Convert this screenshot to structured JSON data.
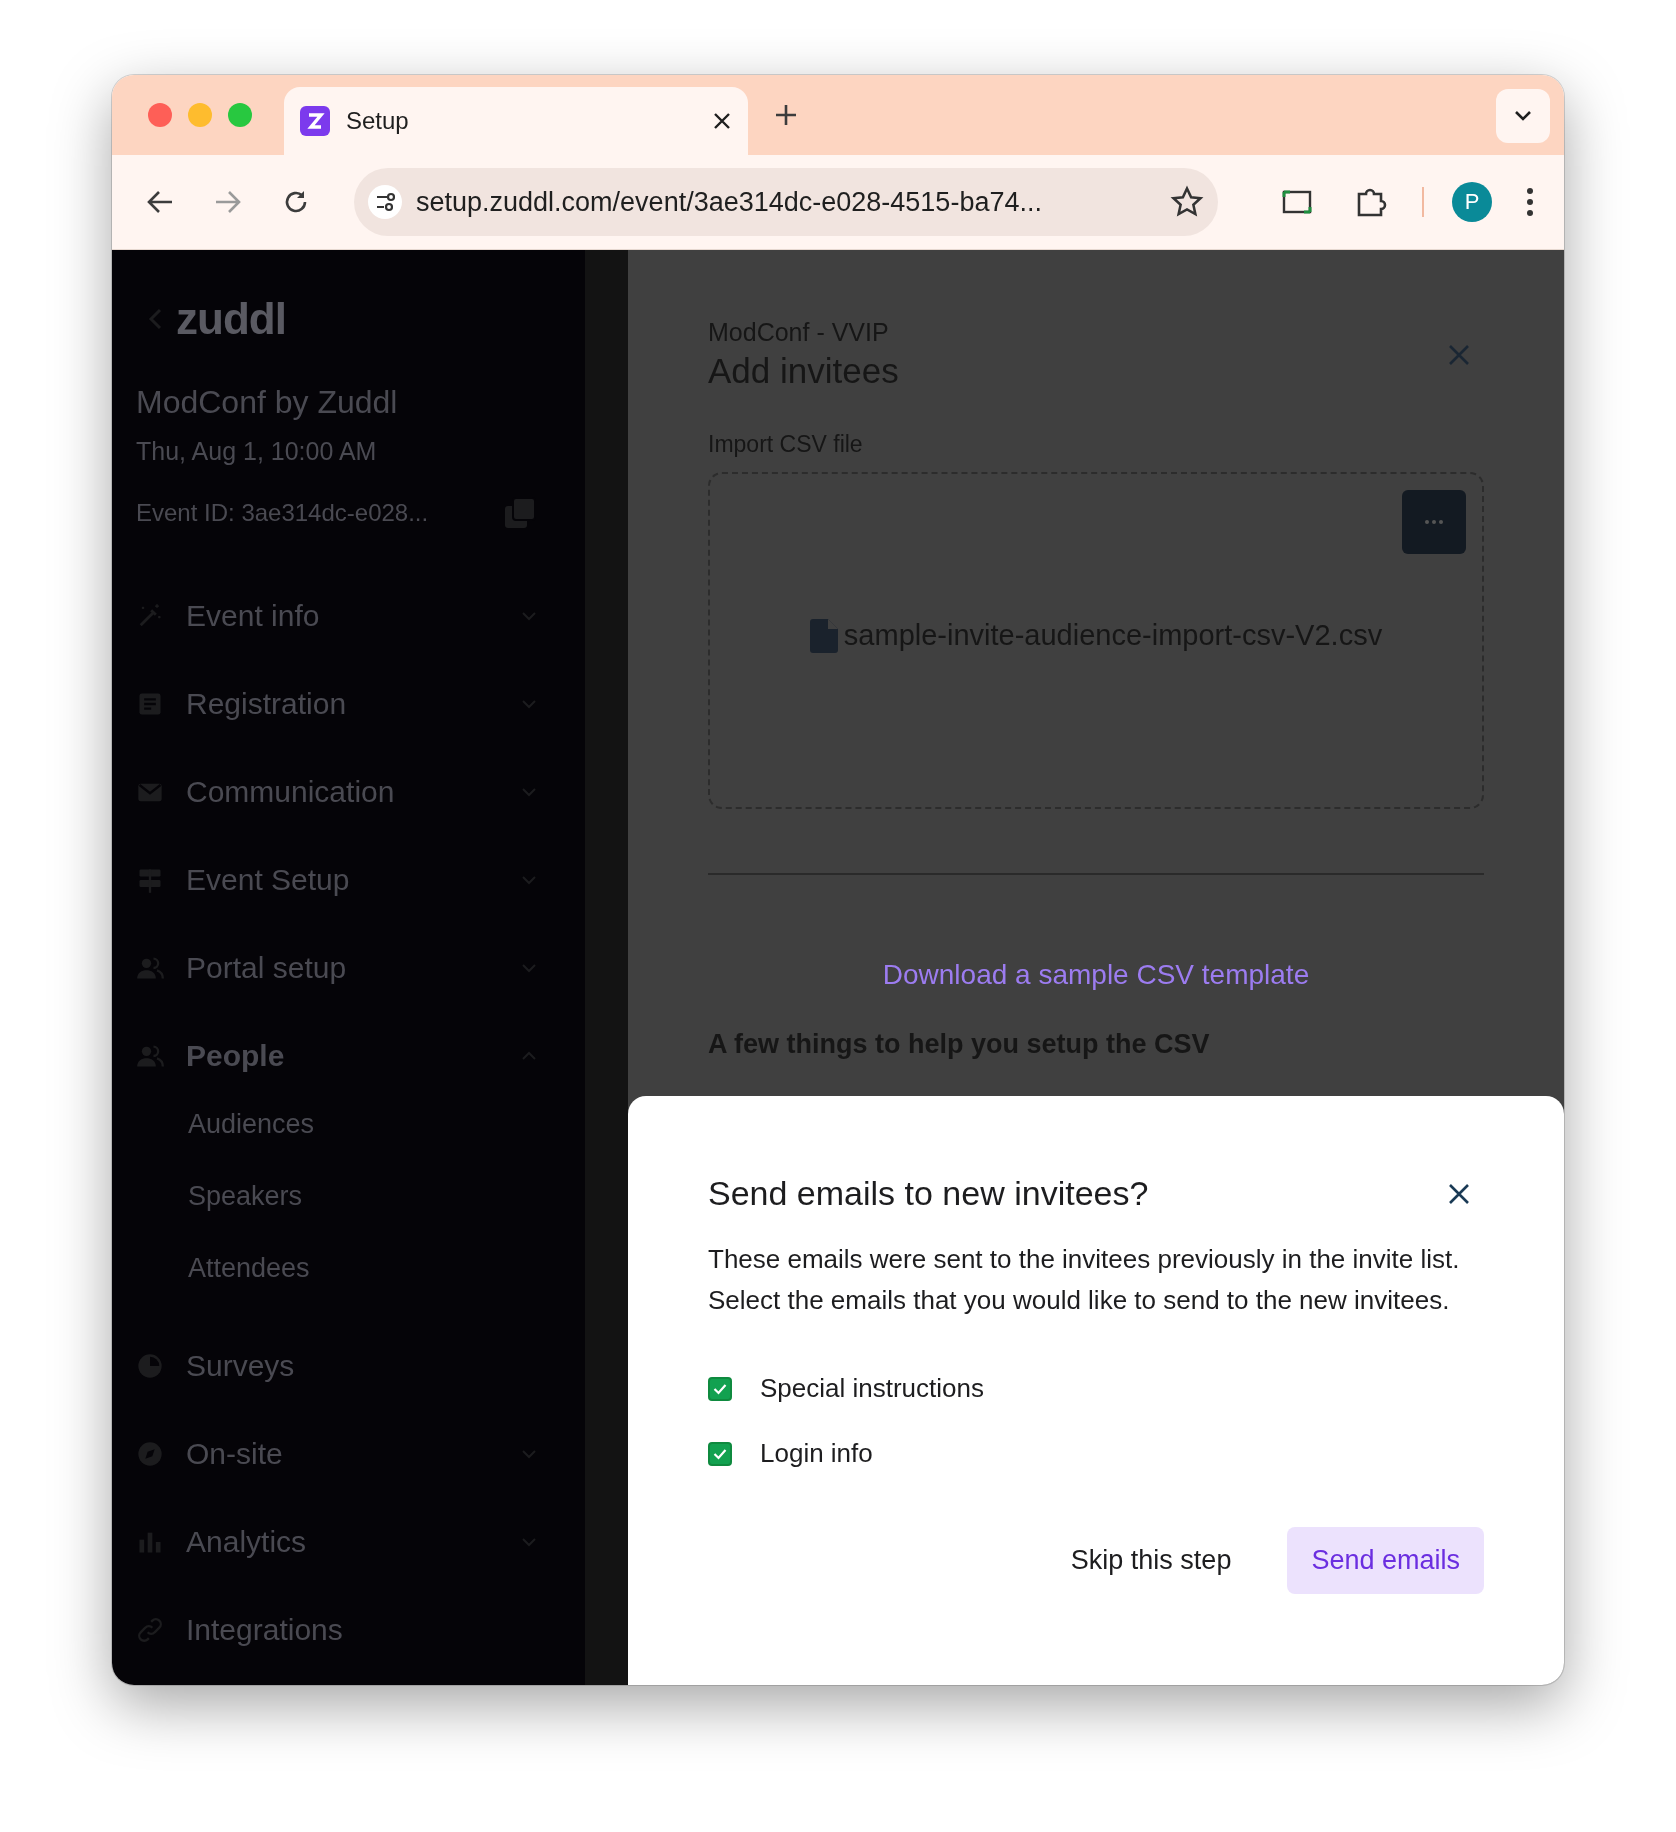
{
  "browser": {
    "tab_title": "Setup",
    "url": "setup.zuddl.com/event/3ae314dc-e028-4515-ba74...",
    "profile_initial": "P"
  },
  "sidebar": {
    "logo": "zuddl",
    "event_name": "ModConf by Zuddl",
    "event_date": "Thu, Aug 1, 10:00 AM",
    "event_id": "Event ID: 3ae314dc-e028...",
    "items": [
      {
        "label": "Event info",
        "kind": "collapsible",
        "expanded": false
      },
      {
        "label": "Registration",
        "kind": "collapsible",
        "expanded": false
      },
      {
        "label": "Communication",
        "kind": "collapsible",
        "expanded": false
      },
      {
        "label": "Event Setup",
        "kind": "collapsible",
        "expanded": false
      },
      {
        "label": "Portal setup",
        "kind": "collapsible",
        "expanded": false
      },
      {
        "label": "People",
        "kind": "collapsible",
        "expanded": true,
        "children": [
          {
            "label": "Audiences"
          },
          {
            "label": "Speakers"
          },
          {
            "label": "Attendees"
          }
        ]
      },
      {
        "label": "Surveys",
        "kind": "link"
      },
      {
        "label": "On-site",
        "kind": "collapsible",
        "expanded": false
      },
      {
        "label": "Analytics",
        "kind": "collapsible",
        "expanded": false
      },
      {
        "label": "Integrations",
        "kind": "link"
      }
    ]
  },
  "drawer": {
    "subtitle": "ModConf - VVIP",
    "title": "Add invitees",
    "import_label": "Import CSV file",
    "file_name": "sample-invite-audience-import-csv-V2.csv",
    "template_link": "Download a sample CSV template",
    "help_heading": "A few things to help you setup the CSV"
  },
  "dialog": {
    "title": "Send emails to new invitees?",
    "body": "These emails were sent to the invitees previously in the invite list. Select the emails that you would like to send to the new invitees.",
    "options": [
      {
        "label": "Special instructions",
        "checked": true
      },
      {
        "label": "Login info",
        "checked": true
      }
    ],
    "buttons": [
      {
        "label": "Skip this step",
        "kind": "text"
      },
      {
        "label": "Send emails",
        "kind": "primary"
      }
    ]
  }
}
